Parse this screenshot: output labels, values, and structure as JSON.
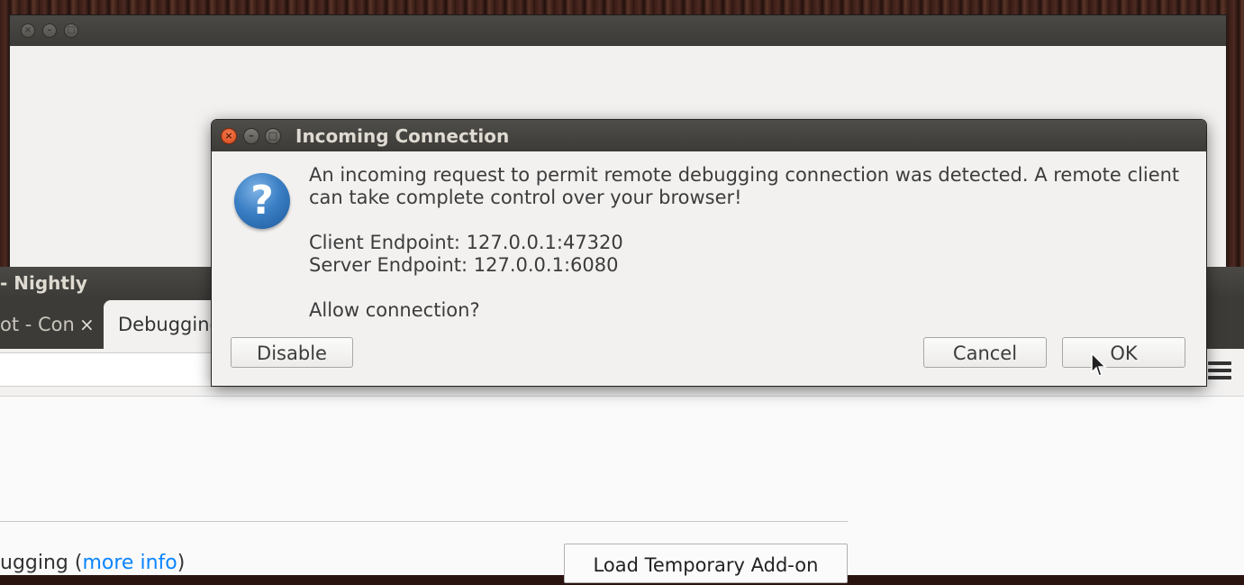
{
  "firefox_window": {
    "title": "- Nightly",
    "tabs": [
      {
        "label": "ot - Con",
        "close_icon": "×"
      },
      {
        "label": "Debugging"
      }
    ],
    "content": {
      "debugging_text": "ugging",
      "open_paren": " (",
      "more_info_link": "more info",
      "close_paren": ")",
      "load_addon_button": "Load Temporary Add-on"
    }
  },
  "dialog": {
    "title": "Incoming Connection",
    "icon": "question-icon",
    "icon_glyph": "?",
    "message": "An incoming request to permit remote debugging connection was detected. A remote client can take complete control over your browser!",
    "client_endpoint": "Client Endpoint: 127.0.0.1:47320",
    "server_endpoint": "Server Endpoint: 127.0.0.1:6080",
    "question": "Allow connection?",
    "buttons": {
      "disable": "Disable",
      "cancel": "Cancel",
      "ok": "OK"
    }
  },
  "colors": {
    "titlebar": "#3c3b37",
    "close_button": "#e0592a",
    "link": "#0a84ff",
    "dialog_bg": "#f2f1f0"
  }
}
